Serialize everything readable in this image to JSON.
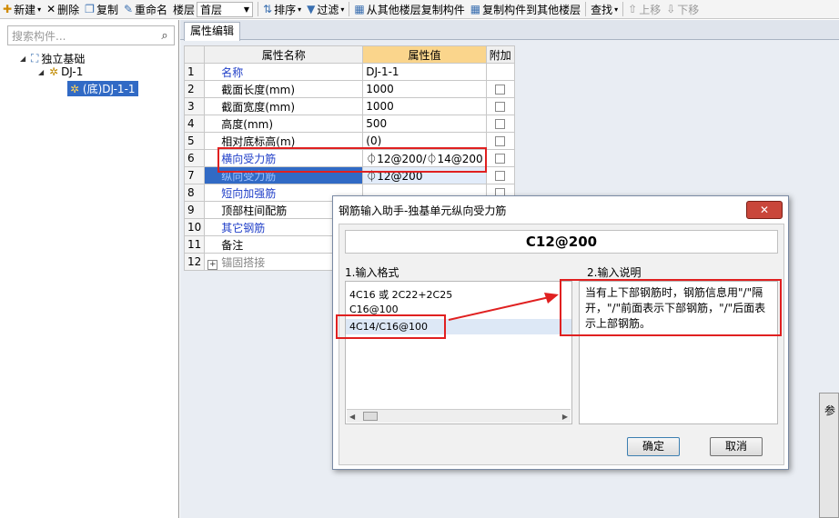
{
  "toolbar": {
    "new_label": "新建",
    "delete_label": "删除",
    "copy_label": "复制",
    "rename_label": "重命名",
    "floor_label": "楼层",
    "floor_value": "首层",
    "sort_label": "排序",
    "filter_label": "过滤",
    "copy_from_floor_label": "从其他楼层复制构件",
    "copy_to_floor_label": "复制构件到其他楼层",
    "find_label": "查找",
    "move_up_label": "上移",
    "move_down_label": "下移"
  },
  "left": {
    "search_placeholder": "搜索构件...",
    "tree_root": "独立基础",
    "tree_child": "DJ-1",
    "tree_leaf": "(底)DJ-1-1"
  },
  "right": {
    "tab_label": "属性编辑",
    "col_name": "属性名称",
    "col_value": "属性值",
    "col_extra": "附加",
    "rows": [
      {
        "num": "1",
        "name": "名称",
        "value": "DJ-1-1"
      },
      {
        "num": "2",
        "name": "截面长度(mm)",
        "value": "1000"
      },
      {
        "num": "3",
        "name": "截面宽度(mm)",
        "value": "1000"
      },
      {
        "num": "4",
        "name": "高度(mm)",
        "value": "500"
      },
      {
        "num": "5",
        "name": "相对底标高(m)",
        "value": "(0)"
      },
      {
        "num": "6",
        "name": "横向受力筋",
        "value": "⏀12@200/⏀14@200"
      },
      {
        "num": "7",
        "name": "纵向受力筋",
        "value": "⏀12@200"
      },
      {
        "num": "8",
        "name": "短向加强筋",
        "value": ""
      },
      {
        "num": "9",
        "name": "顶部柱间配筋",
        "value": ""
      },
      {
        "num": "10",
        "name": "其它钢筋",
        "value": ""
      },
      {
        "num": "11",
        "name": "备注",
        "value": ""
      },
      {
        "num": "12",
        "name": "锚固搭接",
        "value": ""
      }
    ]
  },
  "dialog": {
    "title": "钢筋输入助手-独基单元纵向受力筋",
    "close_label": "✕",
    "value": "C12@200",
    "format_label": "1.输入格式",
    "desc_label": "2.输入说明",
    "formats": [
      "4C16 或 2C22+2C25",
      "C16@100",
      "4C14/C16@100"
    ],
    "description": "当有上下部钢筋时，钢筋信息用\"/\"隔开，\"/\"前面表示下部钢筋，\"/\"后面表示上部钢筋。",
    "ok_label": "确定",
    "cancel_label": "取消"
  },
  "side_panel": {
    "label": "参"
  }
}
